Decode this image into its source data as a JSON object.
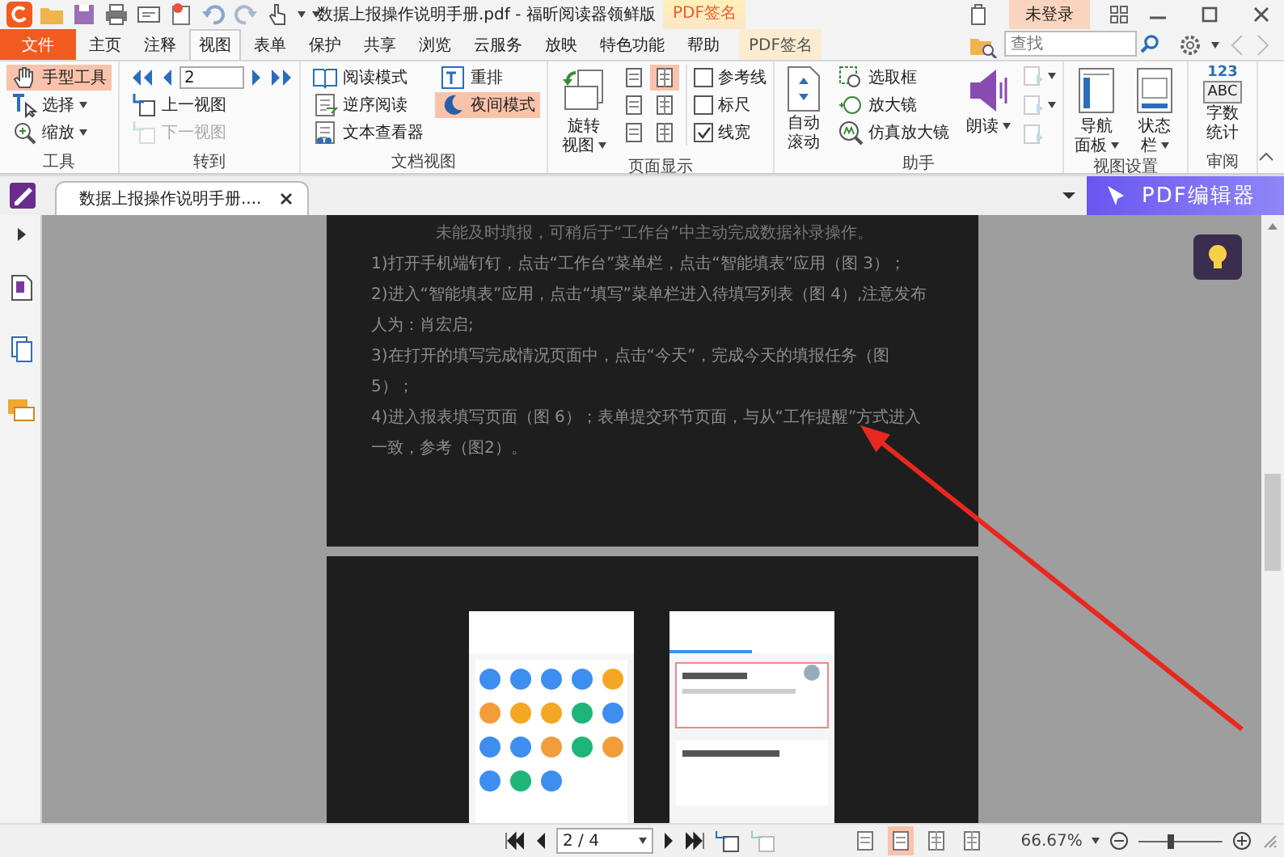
{
  "window": {
    "title": "数据上报操作说明手册.pdf - 福昕阅读器领鲜版",
    "context_group": "PDF签名",
    "login": "未登录"
  },
  "menu_tabs": [
    {
      "label": "文件",
      "kind": "file",
      "selected": false
    },
    {
      "label": "主页",
      "kind": "tab",
      "selected": false
    },
    {
      "label": "注释",
      "kind": "tab",
      "selected": false
    },
    {
      "label": "视图",
      "kind": "tab",
      "selected": true
    },
    {
      "label": "表单",
      "kind": "tab",
      "selected": false
    },
    {
      "label": "保护",
      "kind": "tab",
      "selected": false
    },
    {
      "label": "共享",
      "kind": "tab",
      "selected": false
    },
    {
      "label": "浏览",
      "kind": "tab",
      "selected": false
    },
    {
      "label": "云服务",
      "kind": "tab",
      "selected": false
    },
    {
      "label": "放映",
      "kind": "tab",
      "selected": false
    },
    {
      "label": "特色功能",
      "kind": "tab",
      "selected": false
    },
    {
      "label": "帮助",
      "kind": "tab",
      "selected": false
    },
    {
      "label": "PDF签名",
      "kind": "context",
      "selected": false
    }
  ],
  "search": {
    "placeholder": "查找"
  },
  "ribbon": [
    {
      "kind": "tools",
      "label": "工具",
      "items": [
        {
          "label": "手型工具",
          "selected": true,
          "dropdown": false
        },
        {
          "label": "选择",
          "selected": false,
          "dropdown": true
        },
        {
          "label": "缩放",
          "selected": false,
          "dropdown": true
        }
      ]
    },
    {
      "kind": "goto",
      "label": "转到",
      "page": "2",
      "items": [
        {
          "label": "上一视图",
          "disabled": false
        },
        {
          "label": "下一视图",
          "disabled": true
        }
      ]
    },
    {
      "kind": "docview",
      "label": "文档视图",
      "items": [
        {
          "label": "阅读模式",
          "selected": false
        },
        {
          "label": "逆序阅读",
          "selected": false
        },
        {
          "label": "文本查看器",
          "selected": false
        },
        {
          "label": "重排",
          "selected": false
        },
        {
          "label": "夜间模式",
          "selected": true
        }
      ]
    },
    {
      "kind": "pagedisplay",
      "label": "页面显示",
      "rotate": {
        "lines": [
          "旋转",
          "视图"
        ],
        "dropdown": true
      },
      "layouts": [
        {
          "selected": false
        },
        {
          "selected": true
        },
        {
          "selected": false
        },
        {
          "selected": false
        },
        {
          "selected": false
        },
        {
          "selected": false
        }
      ],
      "checkboxes": [
        {
          "label": "参考线",
          "checked": false
        },
        {
          "label": "标尺",
          "checked": false
        },
        {
          "label": "线宽",
          "checked": true
        }
      ]
    },
    {
      "kind": "assist",
      "label": "助手",
      "scroll": {
        "lines": [
          "自动",
          "滚动"
        ]
      },
      "tools": [
        {
          "label": "选取框"
        },
        {
          "label": "放大镜"
        },
        {
          "label": "仿真放大镜"
        }
      ],
      "read": {
        "lines": [
          "朗读"
        ],
        "dropdown": true
      }
    },
    {
      "kind": "big",
      "label": "视图设置",
      "items": [
        {
          "lines": [
            "导航",
            "面板"
          ],
          "dropdown": true
        },
        {
          "lines": [
            "状态",
            "栏"
          ],
          "dropdown": true
        }
      ]
    },
    {
      "kind": "big",
      "label": "审阅",
      "items": [
        {
          "lines": [
            "字数",
            "统计"
          ],
          "dropdown": false,
          "icon_text": [
            "123",
            "ABC"
          ]
        }
      ]
    }
  ],
  "doc_tabs": [
    {
      "title": "数据上报操作说明手册....",
      "selected": true
    }
  ],
  "editor_button": "PDF编辑器",
  "pages": [
    {
      "paragraphs": [
        "未能及时填报，可稍后于“工作台”中主动完成数据补录操作。",
        "1)打开手机端钉钉，点击“工作台”菜单栏，点击“智能填表”应用（图 3）；",
        "2)进入“智能填表”应用，点击“填写”菜单栏进入待填写列表（图 4）,注意发布人为：肖宏启;",
        "3)在打开的填写完成情况页面中，点击“今天”，完成今天的填报任务（图 5）；",
        "4)进入报表填写页面（图 6）；表单提交环节页面，与从“工作提醒”方式进入一致，参考（图2）。"
      ]
    },
    {
      "figures": [
        {
          "kind": "picture"
        },
        {
          "kind": "picture"
        }
      ]
    }
  ],
  "status_bar": {
    "page": "2 / 4",
    "layouts": [
      {
        "selected": false
      },
      {
        "selected": true
      },
      {
        "selected": false
      },
      {
        "selected": false
      }
    ],
    "zoom": "66.67%",
    "zoom_slider": {
      "level": 0.38
    }
  }
}
